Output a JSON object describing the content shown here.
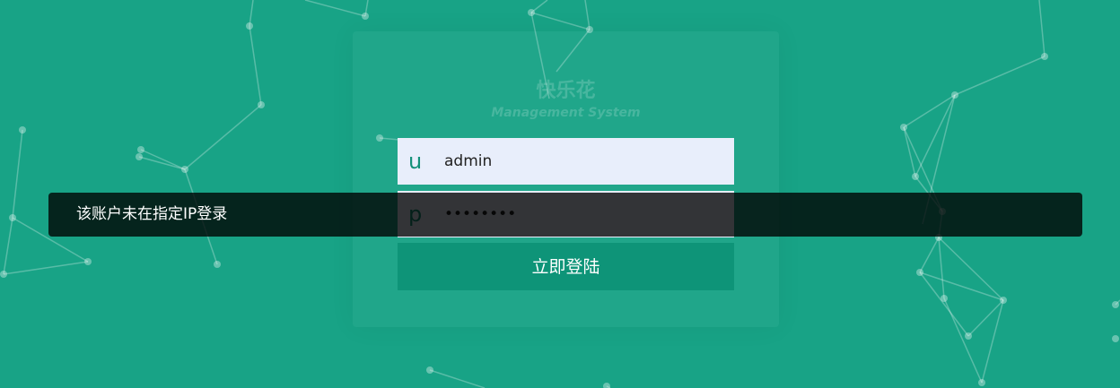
{
  "brand": {
    "title": "快乐花",
    "subtitle": "Management System"
  },
  "login_form": {
    "username": {
      "prefix": "u",
      "value": "admin"
    },
    "password": {
      "prefix": "p",
      "value": "••••••••"
    },
    "submit_label": "立即登陆"
  },
  "toast": {
    "message": "该账户未在指定IP登录"
  },
  "colors": {
    "background": "#18a386",
    "button": "#0e9478",
    "input_bg": "#e8eefb",
    "toast_bg": "rgba(0,0,0,0.78)"
  }
}
